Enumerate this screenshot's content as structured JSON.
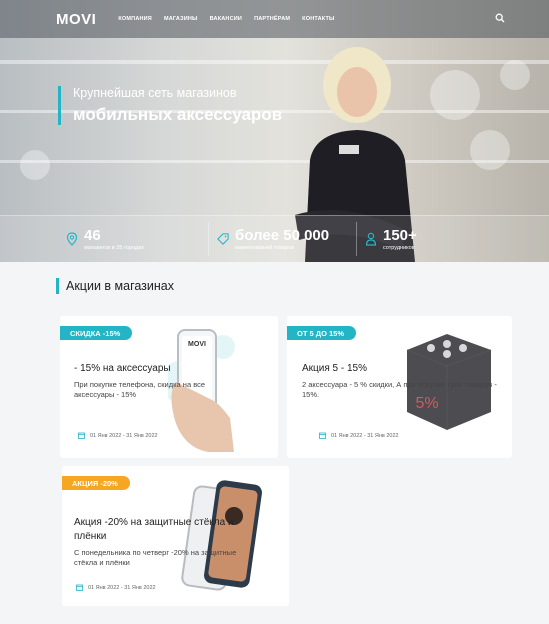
{
  "header": {
    "logo": "MOVI",
    "nav": [
      "КОМПАНИЯ",
      "МАГАЗИНЫ",
      "ВАКАНСИИ",
      "ПАРТНЁРАМ",
      "КОНТАКТЫ"
    ],
    "search_icon": "search-icon"
  },
  "hero": {
    "line1": "Крупнейшая сеть магазинов",
    "line2": "мобильных аксессуаров",
    "stats": [
      {
        "icon": "location-pin-icon",
        "value": "46",
        "label": "магазинов в 25 городах"
      },
      {
        "icon": "tag-icon",
        "value": "более 50 000",
        "label": "наименований товаров"
      },
      {
        "icon": "person-icon",
        "value": "150+",
        "label": "сотрудников"
      }
    ]
  },
  "promo": {
    "title": "Акции в магазинах",
    "colors": {
      "teal": "#23b5c6",
      "orange": "#f5a623"
    },
    "cards": [
      {
        "badge": "СКИДКА -15%",
        "title": "- 15% на аксессуары",
        "desc": "При покупке телефона, скидка на все аксессуары - 15%",
        "date": "01 Янв 2022 - 31 Янв 2022",
        "image_label": "MOVI"
      },
      {
        "badge": "ОТ 5 ДО 15%",
        "title": "Акция 5 - 15%",
        "desc": "2 аксессуара - 5 % скидки, А при покупке трех товаров - 15%.",
        "date": "01 Янв 2022 - 31 Янв 2022",
        "image_label": "5%"
      },
      {
        "badge": "АКЦИЯ -20%",
        "title": "Акция -20% на защитные стёкла и плёнки",
        "desc": "С понедельника по четверг -20% на защитные стёкла и плёнки",
        "date": "01 Янв 2022 - 31 Янв 2022"
      }
    ]
  }
}
